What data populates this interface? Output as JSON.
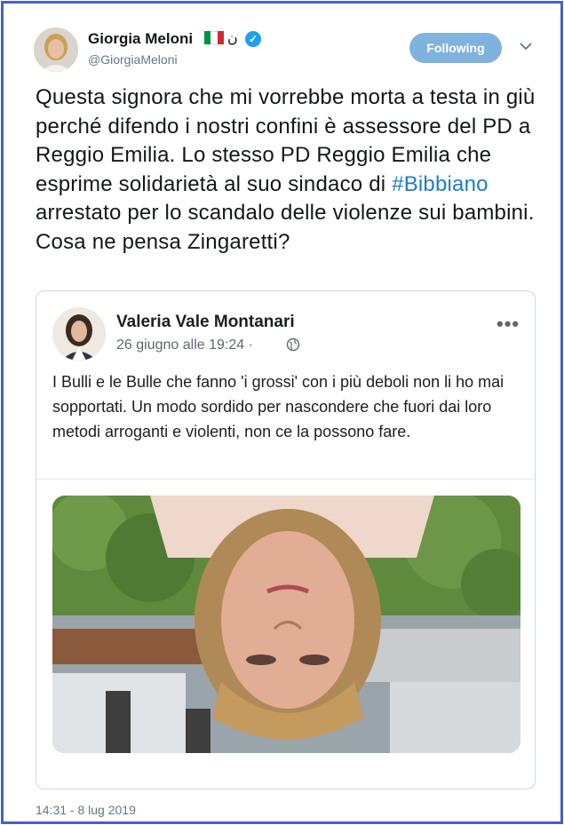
{
  "author": {
    "name": "Giorgia Meloni",
    "arabic_suffix": "ن",
    "handle": "@GiorgiaMeloni",
    "verified_label": "✓",
    "flag_colors": [
      "#009246",
      "#ffffff",
      "#ce2b37"
    ]
  },
  "follow_button": {
    "label": "Following"
  },
  "tweet": {
    "text_part1": "Questa signora che mi vorrebbe morta a testa in giù perché difendo i nostri confini è assessore del PD a Reggio Emilia. Lo stesso PD Reggio Emilia che esprime solidarietà al suo sindaco di ",
    "hashtag": "#Bibbiano",
    "text_part2": " arrestato per lo scandalo delle violenze sui bambini. Cosa ne pensa Zingaretti?",
    "timestamp": "14:31 - 8 lug 2019"
  },
  "embedded_post": {
    "author": "Valeria Vale Montanari",
    "date": "26 giugno alle 19:24 ·",
    "more_label": "•••",
    "text": "I Bulli e le Bulle che fanno 'i grossi' con i più deboli non li ho mai sopportati. Un modo sordido per nascondere che fuori dai loro metodi arroganti e violenti, non ce la possono fare."
  },
  "colors": {
    "frame_border": "#4a5fc9",
    "follow_button_bg": "#7fb3de",
    "hashtag": "#1b7ec9",
    "verified": "#1da1f2"
  },
  "icons": [
    "chevron-down-icon",
    "verified-badge-icon",
    "globe-icon",
    "more-options-icon"
  ]
}
